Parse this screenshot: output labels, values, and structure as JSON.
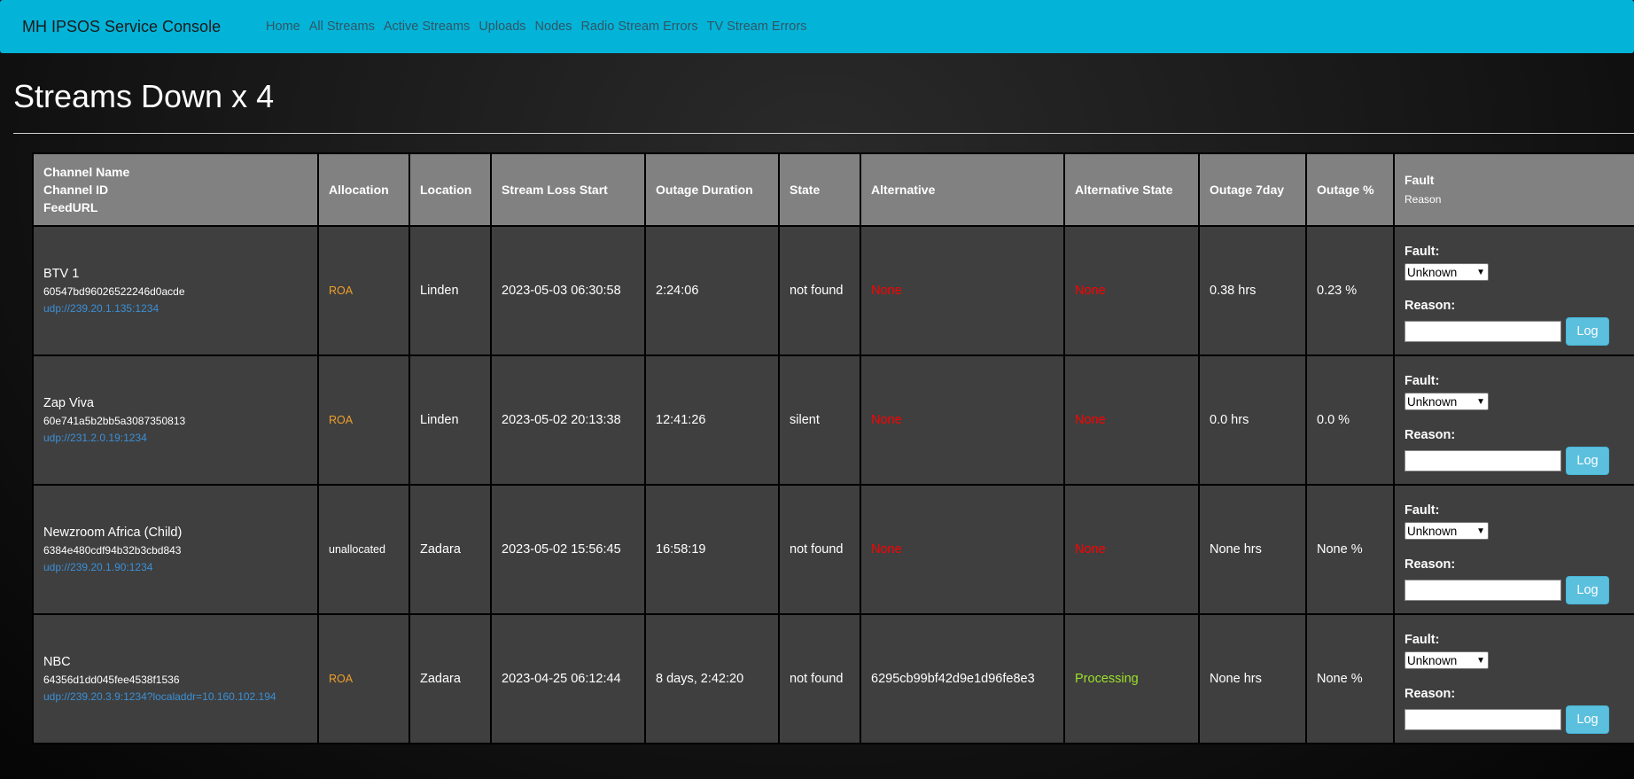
{
  "navbar": {
    "brand": "MH IPSOS Service Console",
    "links": [
      "Home",
      "All Streams",
      "Active Streams",
      "Uploads",
      "Nodes",
      "Radio Stream Errors",
      "TV Stream Errors"
    ]
  },
  "page": {
    "title": "Streams Down x 4"
  },
  "table": {
    "headers": {
      "channel_line1": "Channel Name",
      "channel_line2": "Channel ID",
      "channel_line3": "FeedURL",
      "allocation": "Allocation",
      "location": "Location",
      "stream_loss_start": "Stream Loss Start",
      "outage_duration": "Outage Duration",
      "state": "State",
      "alternative": "Alternative",
      "alternative_state": "Alternative State",
      "outage_7day": "Outage 7day",
      "outage_pct": "Outage %",
      "fault": "Fault",
      "fault_sub": "Reason"
    },
    "rows": [
      {
        "name": "BTV 1",
        "id": "60547bd96026522246d0acde",
        "url": "udp://239.20.1.135:1234",
        "allocation": "ROA",
        "location": "Linden",
        "start": "2023-05-03 06:30:58",
        "duration": "2:24:06",
        "state": "not found",
        "alternative": "None",
        "alt_state": "None",
        "outage_7day": "0.38 hrs",
        "outage_pct": "0.23 %",
        "fault_label": "Fault:",
        "fault_value": "Unknown",
        "reason_label": "Reason:",
        "reason_value": "",
        "log": "Log"
      },
      {
        "name": "Zap Viva",
        "id": "60e741a5b2bb5a3087350813",
        "url": "udp://231.2.0.19:1234",
        "allocation": "ROA",
        "location": "Linden",
        "start": "2023-05-02 20:13:38",
        "duration": "12:41:26",
        "state": "silent",
        "alternative": "None",
        "alt_state": "None",
        "outage_7day": "0.0 hrs",
        "outage_pct": "0.0 %",
        "fault_label": "Fault:",
        "fault_value": "Unknown",
        "reason_label": "Reason:",
        "reason_value": "",
        "log": "Log"
      },
      {
        "name": "Newzroom Africa (Child)",
        "id": "6384e480cdf94b32b3cbd843",
        "url": "udp://239.20.1.90:1234",
        "allocation": "unallocated",
        "location": "Zadara",
        "start": "2023-05-02 15:56:45",
        "duration": "16:58:19",
        "state": "not found",
        "alternative": "None",
        "alt_state": "None",
        "outage_7day": "None hrs",
        "outage_pct": "None %",
        "fault_label": "Fault:",
        "fault_value": "Unknown",
        "reason_label": "Reason:",
        "reason_value": "",
        "log": "Log"
      },
      {
        "name": "NBC",
        "id": "64356d1dd045fee4538f1536",
        "url": "udp://239.20.3.9:1234?localaddr=10.160.102.194",
        "allocation": "ROA",
        "location": "Zadara",
        "start": "2023-04-25 06:12:44",
        "duration": "8 days, 2:42:20",
        "state": "not found",
        "alternative": "6295cb99bf42d9e1d96fe8e3",
        "alt_state": "Processing",
        "outage_7day": "None hrs",
        "outage_pct": "None %",
        "fault_label": "Fault:",
        "fault_value": "Unknown",
        "reason_label": "Reason:",
        "reason_value": "",
        "log": "Log"
      }
    ]
  },
  "colors": {
    "navbar_bg": "#04b3d8",
    "roa": "#f0a02a",
    "none_red": "#ff0000",
    "processing": "#9ce02a",
    "link": "#3b8fd6",
    "log_button": "#5bc0de"
  }
}
